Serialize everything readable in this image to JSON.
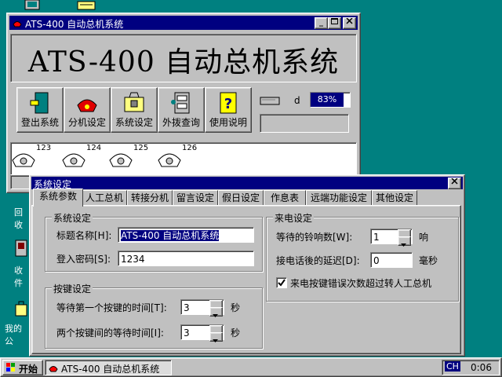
{
  "desktop": {
    "icon_labels": [
      "回收",
      "收件",
      "我的公"
    ]
  },
  "main_window": {
    "title": "ATS-400 自动总机系统",
    "banner": "ATS-400 自动总机系统",
    "toolbar": [
      {
        "label": "登出系统",
        "icon": "door-exit-icon"
      },
      {
        "label": "分机设定",
        "icon": "phone-extension-icon"
      },
      {
        "label": "系统设定",
        "icon": "toolbox-icon"
      },
      {
        "label": "外拨查询",
        "icon": "cabinet-icon"
      },
      {
        "label": "使用说明",
        "icon": "help-icon"
      }
    ],
    "status": {
      "indicator_text": "d",
      "progress_text": "83%",
      "progress_value": 0.83
    },
    "extensions": [
      "123",
      "124",
      "125",
      "126"
    ]
  },
  "dialog": {
    "title": "系统设定",
    "tabs": [
      "系统参数",
      "人工总机",
      "转接分机",
      "留言设定",
      "假日设定",
      "作息表",
      "远端功能设定",
      "其他设定"
    ],
    "active_tab": 0,
    "system_group": {
      "title": "系统设定",
      "name_label": "标题名称[H]:",
      "name_value": "ATS-400 自动总机系统",
      "password_label": "登入密码[S]:",
      "password_value": "1234"
    },
    "key_group": {
      "title": "按键设定",
      "first_key_label": "等待第一个按键的时间[T]:",
      "first_key_value": "3",
      "between_keys_label": "两个按键间的等待时间[I]:",
      "between_keys_value": "3",
      "unit": "秒"
    },
    "call_group": {
      "title": "来电设定",
      "rings_label": "等待的铃响数[W]:",
      "rings_value": "1",
      "rings_unit": "响",
      "delay_label": "接电话後的延迟[D]:",
      "delay_value": "0",
      "delay_unit": "毫秒",
      "checkbox_label": "来电按键错误次数超过转人工总机",
      "checkbox_checked": true
    }
  },
  "taskbar": {
    "start_label": "开始",
    "task_label": "ATS-400 自动总机系统",
    "ime": "CH",
    "clock": "0:06"
  },
  "colors": {
    "desktop": "#008080",
    "titlebar": "#000080",
    "face": "#c0c0c0"
  }
}
